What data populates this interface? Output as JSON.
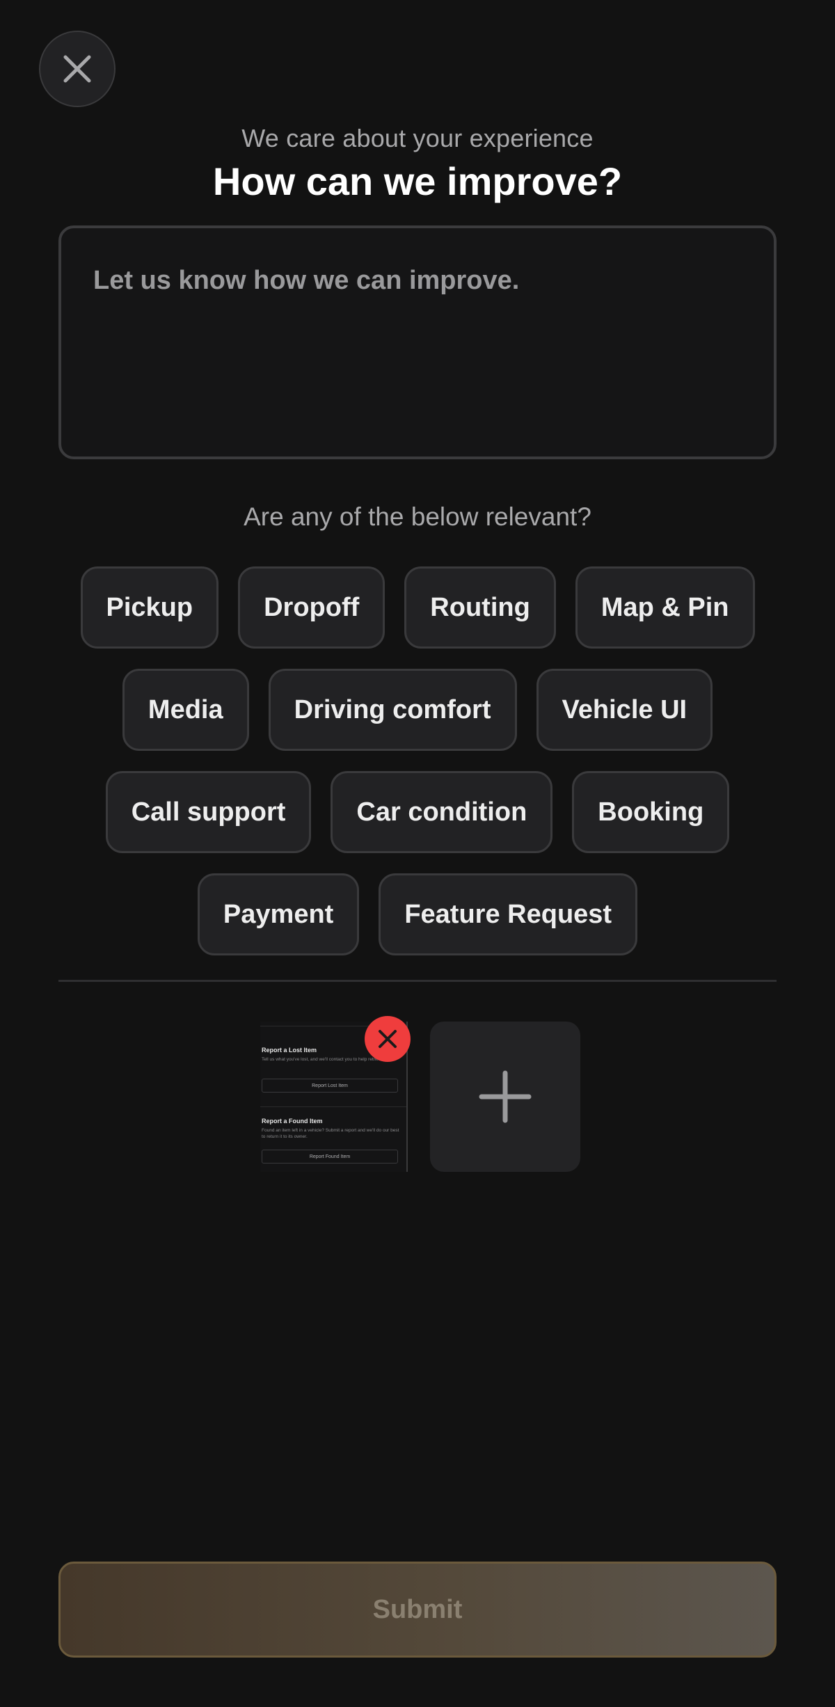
{
  "header": {
    "close_icon": "close-icon",
    "subtitle": "We care about your experience",
    "title": "How can we improve?"
  },
  "feedback": {
    "placeholder": "Let us know how we can improve.",
    "value": ""
  },
  "topics": {
    "question": "Are any of the below relevant?",
    "rows": [
      [
        "Pickup",
        "Dropoff",
        "Routing",
        "Map & Pin"
      ],
      [
        "Media",
        "Driving comfort",
        "Vehicle UI"
      ],
      [
        "Call support",
        "Car condition",
        "Booking"
      ],
      [
        "Payment",
        "Feature Request"
      ]
    ]
  },
  "attachments": {
    "screenshot": {
      "lost_heading": "Report a Lost Item",
      "lost_desc": "Tell us what you've lost, and we'll contact you to help retrieve it.",
      "lost_button": "Report Lost Item",
      "found_heading": "Report a Found Item",
      "found_desc": "Found an item left in a vehicle? Submit a report and we'll do our best to return it to its owner.",
      "found_button": "Report Found Item"
    },
    "remove_icon": "close-icon",
    "add_icon": "plus-icon"
  },
  "submit": {
    "label": "Submit"
  },
  "colors": {
    "background": "#121212",
    "chip_bg": "#222224",
    "remove_red": "#ef3d3d",
    "submit_gold": "#54493a"
  }
}
